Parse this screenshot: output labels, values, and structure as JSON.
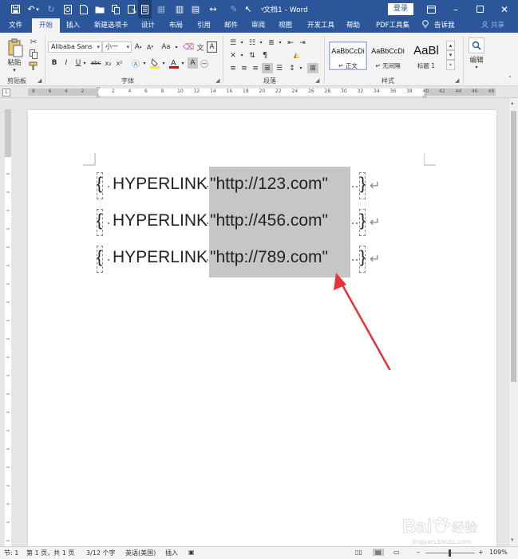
{
  "titlebar": {
    "doc_title": "文档1 - Word",
    "login_label": "登录"
  },
  "tabs": [
    {
      "label": "文件"
    },
    {
      "label": "开始"
    },
    {
      "label": "插入"
    },
    {
      "label": "新建选项卡"
    },
    {
      "label": "设计"
    },
    {
      "label": "布局"
    },
    {
      "label": "引用"
    },
    {
      "label": "邮件"
    },
    {
      "label": "审阅"
    },
    {
      "label": "视图"
    },
    {
      "label": "开发工具"
    },
    {
      "label": "帮助"
    },
    {
      "label": "PDF工具集"
    },
    {
      "label": "告诉我"
    },
    {
      "label": "共享"
    }
  ],
  "ribbon": {
    "clipboard": {
      "paste_label": "粘贴",
      "group_label": "剪贴板"
    },
    "font": {
      "font_name": "Alibaba Sans",
      "font_size": "小一",
      "group_label": "字体",
      "bold": "B",
      "italic": "I",
      "underline": "U",
      "strike": "abc",
      "subscript": "x₂",
      "superscript": "x²",
      "grow": "A",
      "shrink": "A",
      "case": "Aa",
      "clear": "A"
    },
    "paragraph": {
      "group_label": "段落"
    },
    "styles": {
      "group_label": "样式",
      "items": [
        {
          "sample": "AaBbCcDi",
          "name": "↵ 正文"
        },
        {
          "sample": "AaBbCcDi",
          "name": "↵ 无间隔"
        },
        {
          "sample": "AaBl",
          "name": "标题 1"
        }
      ]
    },
    "editing": {
      "label": "编辑"
    }
  },
  "ruler": {
    "corner": "L",
    "numbers": [
      "8",
      "6",
      "4",
      "2",
      "2",
      "4",
      "6",
      "8",
      "10",
      "12",
      "14",
      "16",
      "18",
      "20",
      "22",
      "24",
      "26",
      "28",
      "30",
      "32",
      "34",
      "36",
      "38",
      "40",
      "42",
      "44",
      "46",
      "48"
    ]
  },
  "document": {
    "lines": [
      {
        "open": "{",
        "code": "HYPERLINK",
        "url": "\"http://123.com\"",
        "close": "}"
      },
      {
        "open": "{",
        "code": "HYPERLINK",
        "url": "\"http://456.com\"",
        "close": "}"
      },
      {
        "open": "{",
        "code": "HYPERLINK",
        "url": "\"http://789.com\"",
        "close": "}"
      }
    ],
    "para_mark": "↵"
  },
  "status": {
    "section": "节: 1",
    "page": "第 1 页，共 1 页",
    "words": "3/12 个字",
    "language": "英语(美国)",
    "mode": "插入",
    "zoom": "109%"
  },
  "watermark": {
    "text": "Bai 经验",
    "sub": "jingyan.baidu.com"
  },
  "colors": {
    "title_bar": "#2b579a",
    "ribbon": "#f3f3f3",
    "field_shade": "#c6c6c6",
    "arrow": "#e8323c"
  }
}
